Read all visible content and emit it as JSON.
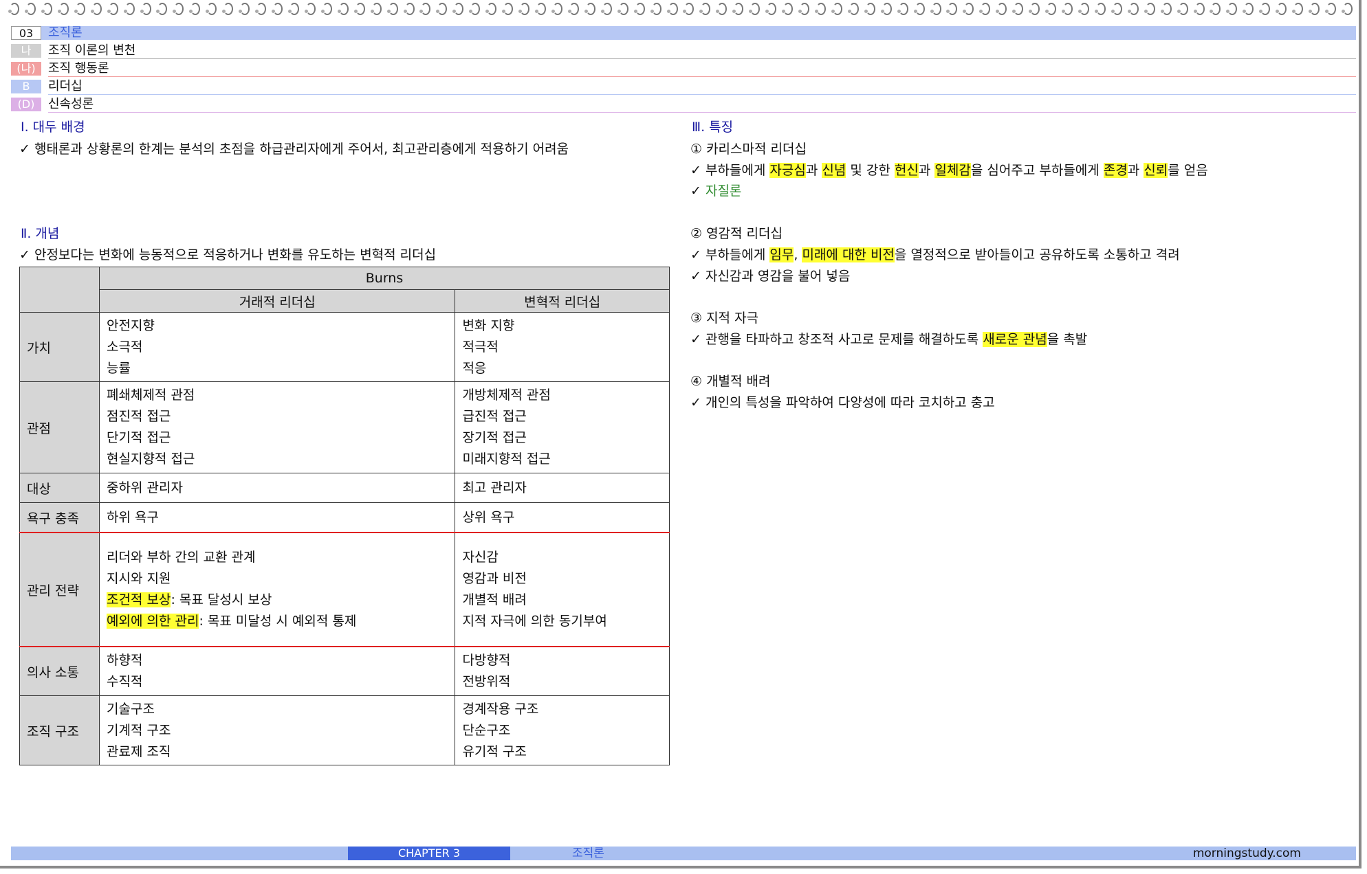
{
  "headers": [
    {
      "tag": "03",
      "label": "조직론",
      "tag_bg": "#ffffff",
      "tag_color": "#111111",
      "bar_bg": "#b7c8f4",
      "label_color": "#3c62dc"
    },
    {
      "tag": "나",
      "label": "조직 이론의 변천",
      "tag_bg": "#d0d0d0",
      "tag_color": "#ffffff",
      "rule": "#b0b0b0"
    },
    {
      "tag": "(나)",
      "label": "조직 행동론",
      "tag_bg": "#f2a0a0",
      "tag_color": "#ffffff",
      "rule": "#f2a0a0"
    },
    {
      "tag": "B",
      "label": "리더십",
      "tag_bg": "#b7c8f4",
      "tag_color": "#ffffff",
      "rule": "#b7c8f4"
    },
    {
      "tag": "(D)",
      "label": "신속성론",
      "tag_bg": "#dcb0e6",
      "tag_color": "#ffffff",
      "rule": "#dcb0e6"
    }
  ],
  "left": {
    "s1_title": "Ⅰ. 대두 배경",
    "s1_line": "✓ 행태론과 상황론의 한계는 분석의 초점을 하급관리자에게 주어서, 최고관리층에게 적용하기 어려움",
    "s2_title": "Ⅱ. 개념",
    "s2_line": "✓ 안정보다는 변화에 능동적으로 적응하거나 변화를 유도하는 변혁적 리더십"
  },
  "table": {
    "super_header": "Burns",
    "col1": "거래적 리더십",
    "col2": "변혁적 리더십",
    "rows": [
      {
        "head": "가치",
        "a": [
          "안전지향",
          "소극적",
          "능률"
        ],
        "b": [
          "변화 지향",
          "적극적",
          "적응"
        ]
      },
      {
        "head": "관점",
        "a": [
          "폐쇄체제적 관점",
          "점진적 접근",
          "단기적 접근",
          "현실지향적 접근"
        ],
        "b": [
          "개방체제적 관점",
          "급진적 접근",
          "장기적 접근",
          "미래지향적 접근"
        ]
      },
      {
        "head": "대상",
        "a": [
          "중하위 관리자"
        ],
        "b": [
          "최고 관리자"
        ]
      },
      {
        "head": "욕구 충족",
        "a": [
          "하위 욕구"
        ],
        "b": [
          "상위 욕구"
        ]
      },
      {
        "head": "관리 전략",
        "a_plain": [
          "리더와 부하 간의 교환 관계",
          "지시와 지원"
        ],
        "a_hl": [
          {
            "hl": "조건적 보상",
            "rest": ": 목표 달성시 보상"
          },
          {
            "hl": "예외에 의한 관리",
            "rest": ": 목표 미달성 시 예외적 통제"
          }
        ],
        "b": [
          "자신감",
          "영감과 비전",
          "개별적 배려",
          "지적 자극에 의한 동기부여"
        ]
      },
      {
        "head": "의사 소통",
        "a": [
          "하향적",
          "수직적"
        ],
        "b": [
          "다방향적",
          "전방위적"
        ]
      },
      {
        "head": "조직 구조",
        "a": [
          "기술구조",
          "기계적 구조",
          "관료제 조직"
        ],
        "b": [
          "경계작용 구조",
          "단순구조",
          "유기적 구조"
        ]
      }
    ]
  },
  "right": {
    "title": "Ⅲ. 특징",
    "i1": "① 카리스마적 리더십",
    "i1_l1": [
      {
        "t": "✓ 부하들에게 "
      },
      {
        "t": "자긍심",
        "h": true
      },
      {
        "t": "과 "
      },
      {
        "t": "신념",
        "h": true
      },
      {
        "t": " 및 강한 "
      },
      {
        "t": "헌신",
        "h": true
      },
      {
        "t": "과 "
      },
      {
        "t": "일체감",
        "h": true
      },
      {
        "t": "을 심어주고 부하들에게 "
      },
      {
        "t": "존경",
        "h": true
      },
      {
        "t": "과 "
      },
      {
        "t": "신뢰",
        "h": true
      },
      {
        "t": "를 얻음"
      }
    ],
    "i1_l2_check": "✓ ",
    "i1_l2": "자질론",
    "i2": "② 영감적 리더십",
    "i2_l1": [
      {
        "t": "✓ 부하들에게 "
      },
      {
        "t": "임무",
        "h": true
      },
      {
        "t": ", "
      },
      {
        "t": "미래에 대한 비전",
        "h": true
      },
      {
        "t": "을 열정적으로 받아들이고 공유하도록 소통하고 격려"
      }
    ],
    "i2_l2": "✓ 자신감과 영감을 불어 넣음",
    "i3": "③ 지적 자극",
    "i3_l1": [
      {
        "t": "✓ 관행을 타파하고 창조적 사고로 문제를 해결하도록 "
      },
      {
        "t": "새로운 관념",
        "h": true
      },
      {
        "t": "을 촉발"
      }
    ],
    "i4": "④ 개별적 배려",
    "i4_l1": "✓ 개인의 특성을 파악하여 다양성에 따라 코치하고 충고"
  },
  "footer": {
    "chapter": "CHAPTER 3",
    "title": "조직론",
    "site": "morningstudy.com"
  }
}
